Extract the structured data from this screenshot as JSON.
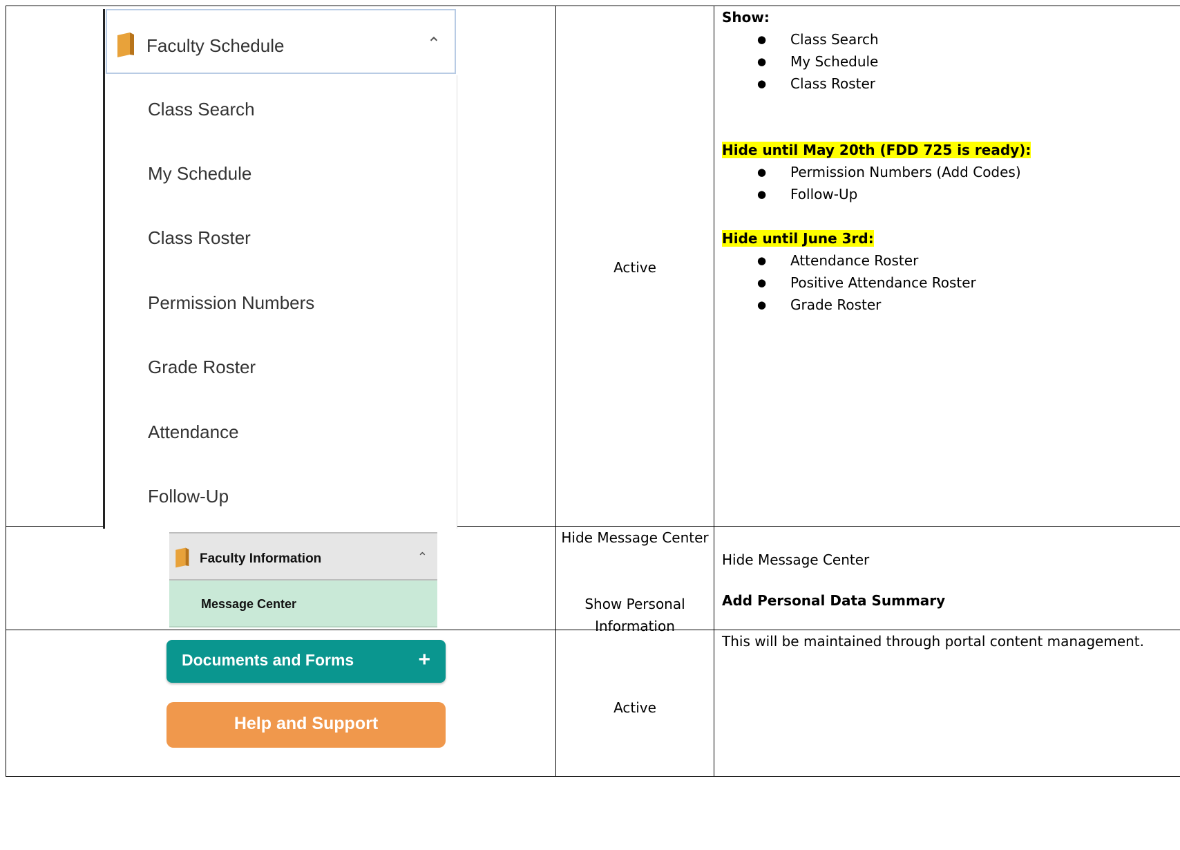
{
  "rows": [
    {
      "menu": {
        "title": "Faculty Schedule",
        "items": [
          "Class Search",
          "My Schedule",
          "Class Roster",
          "Permission Numbers",
          "Grade Roster",
          "Attendance",
          "Follow-Up"
        ]
      },
      "status": "Active",
      "notes": {
        "show_heading": "Show:",
        "show_items": [
          "Class Search",
          "My Schedule",
          "Class Roster"
        ],
        "hide1_heading": "Hide until May 20th (FDD 725 is ready):",
        "hide1_items": [
          "Permission Numbers (Add Codes)",
          "Follow-Up"
        ],
        "hide2_heading": "Hide until June 3rd:",
        "hide2_items": [
          "Attendance Roster",
          "Positive Attendance Roster",
          "Grade Roster"
        ]
      }
    },
    {
      "menu": {
        "title": "Faculty Information",
        "item": "Message Center"
      },
      "status_line1": "Hide Message Center",
      "status_line2": "Show Personal Information",
      "note1": "Hide Message Center",
      "note2": "Add Personal Data Summary"
    },
    {
      "docs_button": "Documents and Forms",
      "docs_plus": "+",
      "help_button": "Help and Support",
      "status": "Active",
      "note": "This will be maintained through portal content management."
    }
  ],
  "colors": {
    "highlight": "#ffff00",
    "teal": "#0a968f",
    "orange": "#f0984c",
    "mint": "#c9e9d7",
    "book": "#e8a23a"
  },
  "icons": {
    "book": "book-icon",
    "chevron": "chevron-up-icon",
    "bullet": "bullet"
  }
}
